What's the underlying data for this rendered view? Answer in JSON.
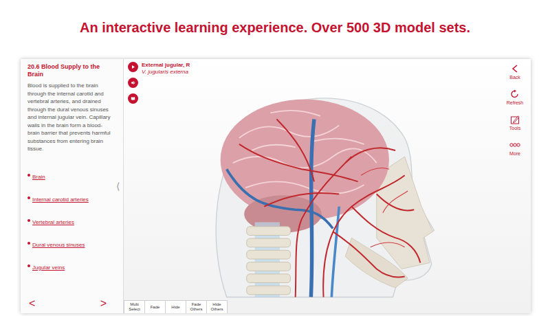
{
  "headline": "An interactive learning experience. Over 500 3D model sets.",
  "lesson": {
    "title": "20.6 Blood Supply to the Brain",
    "body": "Blood is supplied to the brain through the internal carotid and vertebral arteries, and drained through the dural venous sinuses and internal jugular vein. Capillary walls in the brain form a blood-brain barrier that prevents harmful substances from entering brain tissue.",
    "links": [
      "Brain",
      "Internal carotid arteries",
      "Vertebral arteries",
      "Dural venous sinuses",
      "Jugular veins"
    ]
  },
  "pager": {
    "prev": "<",
    "next": ">"
  },
  "collapse_handle": "⟨",
  "selection": {
    "name": "External jugular, R",
    "latin": "V. jugularis externa"
  },
  "tools": [
    {
      "label": "Back"
    },
    {
      "label": "Refresh"
    },
    {
      "label": "Tools"
    },
    {
      "label": "More"
    }
  ],
  "bottom_buttons": [
    "Multi Select",
    "Fade",
    "Hide",
    "Fade Others",
    "Hide Others"
  ]
}
